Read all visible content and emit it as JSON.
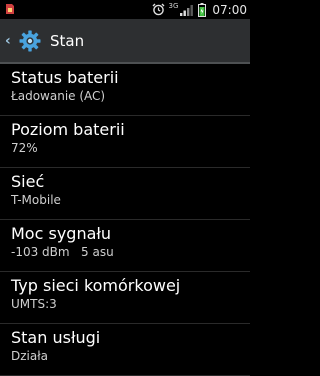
{
  "status_bar": {
    "sim_icon": "sim-card-icon",
    "alarm_icon": "alarm-clock-icon",
    "network_type": "3G",
    "signal_icon": "signal-bars-icon",
    "battery_icon": "battery-charging-icon",
    "time": "07:00",
    "colors": {
      "battery_fill": "#3fbf3f",
      "sim": "#d04040"
    }
  },
  "action_bar": {
    "back_icon": "chevron-left-icon",
    "app_icon": "settings-gear-icon",
    "title": "Stan",
    "colors": {
      "background": "#2d2f31",
      "gear": "#49a3de"
    }
  },
  "items": [
    {
      "title": "Status baterii",
      "value": "Ładowanie (AC)"
    },
    {
      "title": "Poziom baterii",
      "value": "72%"
    },
    {
      "title": "Sieć",
      "value": "T-Mobile"
    },
    {
      "title": "Moc sygnału",
      "value": "-103 dBm   5 asu"
    },
    {
      "title": "Typ sieci komórkowej",
      "value": "UMTS:3"
    },
    {
      "title": "Stan usługi",
      "value": "Działa"
    }
  ]
}
